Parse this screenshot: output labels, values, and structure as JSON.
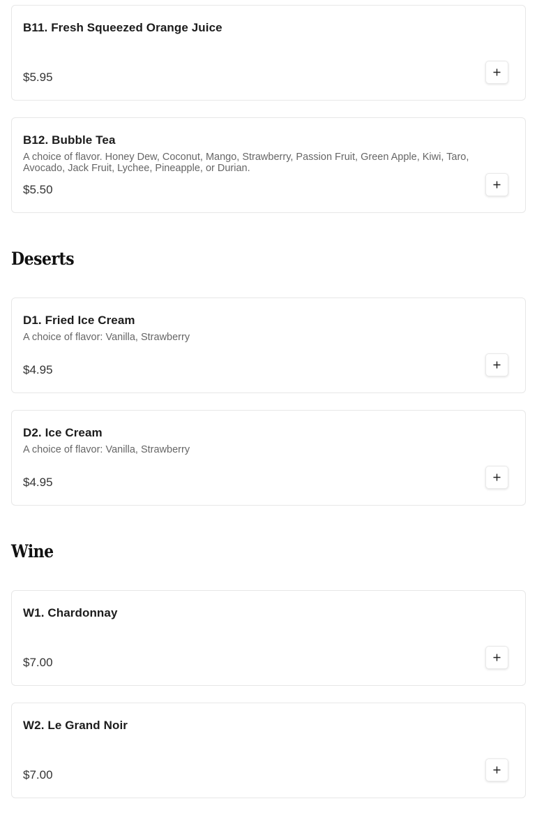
{
  "sections": [
    {
      "title": "",
      "items": [
        {
          "name": "B11. Fresh Squeezed Orange Juice",
          "description": "",
          "price": "$5.95"
        },
        {
          "name": "B12. Bubble Tea",
          "description": "A choice of flavor. Honey Dew, Coconut, Mango, Strawberry, Passion Fruit, Green Apple, Kiwi, Taro, Avocado, Jack Fruit, Lychee, Pineapple, or Durian.",
          "price": "$5.50"
        }
      ]
    },
    {
      "title": "Deserts",
      "items": [
        {
          "name": "D1. Fried Ice Cream",
          "description": "A choice of flavor: Vanilla, Strawberry",
          "price": "$4.95"
        },
        {
          "name": "D2. Ice Cream",
          "description": "A choice of flavor: Vanilla, Strawberry",
          "price": "$4.95"
        }
      ]
    },
    {
      "title": "Wine",
      "items": [
        {
          "name": "W1. Chardonnay",
          "description": "",
          "price": "$7.00"
        },
        {
          "name": "W2. Le Grand Noir",
          "description": "",
          "price": "$7.00"
        }
      ]
    }
  ],
  "icons": {
    "add_button_icon": "plus-icon"
  }
}
